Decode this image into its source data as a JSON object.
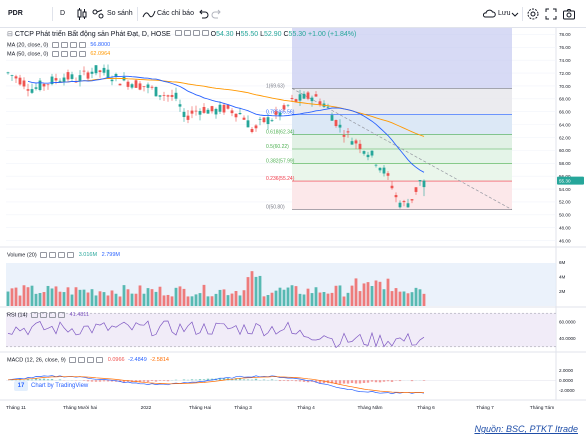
{
  "toolbar": {
    "symbol": "PDR",
    "interval": "D",
    "compare_label": "So sánh",
    "indicators_label": "Các chỉ báo",
    "save_label": "Lưu"
  },
  "legend": {
    "main_title": "CTCP Phát triển Bất động sản Phát Đạt, D, HOSE",
    "open_label": "O",
    "open": "54.30",
    "high_label": "H",
    "high": "55.50",
    "low_label": "L",
    "low": "52.90",
    "close_label": "C",
    "close": "55.30",
    "change": "+1.00 (+1.84%)",
    "ma20_label": "MA (20, close, 0)",
    "ma20_value": "56.8000",
    "ma50_label": "MA (50, close, 0)",
    "ma50_value": "62.0964",
    "volume_label": "Volume (20)",
    "volume_value1": "3.016M",
    "volume_value2": "2.799M",
    "rsi_label": "RSI (14)",
    "rsi_value": "41.4811",
    "macd_label": "MACD (12, 26, close, 9)",
    "macd_v1": "0.0966",
    "macd_v2": "-2.4849",
    "macd_v3": "-2.5814"
  },
  "price_axis": {
    "ticks": [
      "78.00",
      "76.00",
      "74.00",
      "72.00",
      "70.00",
      "68.00",
      "66.00",
      "64.00",
      "62.00",
      "60.00",
      "58.00",
      "56.00",
      "54.00",
      "52.00",
      "50.00",
      "48.00",
      "46.00"
    ],
    "last_price": "55.30"
  },
  "volume_axis": {
    "ticks": [
      "6M",
      "4M",
      "2M"
    ]
  },
  "rsi_axis": {
    "ticks": [
      "60.0000",
      "40.0000"
    ]
  },
  "macd_axis": {
    "ticks": [
      "2.0000",
      "0.0000",
      "-2.0000"
    ]
  },
  "time_axis": {
    "labels": [
      "Tháng 11",
      "Tháng Mười hai",
      "2022",
      "Tháng Hai",
      "Tháng 3",
      "Tháng 4",
      "Tháng Năm",
      "Tháng 6",
      "Tháng 7",
      "Tháng Tám"
    ]
  },
  "fib_levels": [
    {
      "label": "1(69.63)",
      "color": "#787b86"
    },
    {
      "label": "0.786(65.56)",
      "color": "#2962ff"
    },
    {
      "label": "0.618(62.34)",
      "color": "#4caf50"
    },
    {
      "label": "0.5(60.22)",
      "color": "#4caf50"
    },
    {
      "label": "0.382(57.99)",
      "color": "#4caf50"
    },
    {
      "label": "0.236(55.24)",
      "color": "#f23645"
    },
    {
      "label": "0(50.80)",
      "color": "#787b86"
    }
  ],
  "tradingview_label": "Chart by TradingView",
  "source_note": "Nguồn: BSC, PTKT Itrade",
  "colors": {
    "up": "#26a69a",
    "down": "#ef5350",
    "ma20": "#2962ff",
    "ma50": "#ff9800",
    "rsi": "#7e57c2"
  },
  "chart_data": {
    "type": "candlestick",
    "title": "CTCP Phát triển Bất động sản Phát Đạt, D, HOSE",
    "y_range": [
      45,
      79
    ],
    "last": {
      "open": 54.3,
      "high": 55.5,
      "low": 52.9,
      "close": 55.3
    },
    "fibonacci": {
      "high": 69.63,
      "low": 50.8,
      "levels": [
        1,
        0.786,
        0.618,
        0.5,
        0.382,
        0.236,
        0
      ]
    },
    "ma20_last": 56.8,
    "ma50_last": 62.0964,
    "rsi_last": 41.4811,
    "macd": [
      0.0966,
      -2.4849,
      -2.5814
    ]
  }
}
